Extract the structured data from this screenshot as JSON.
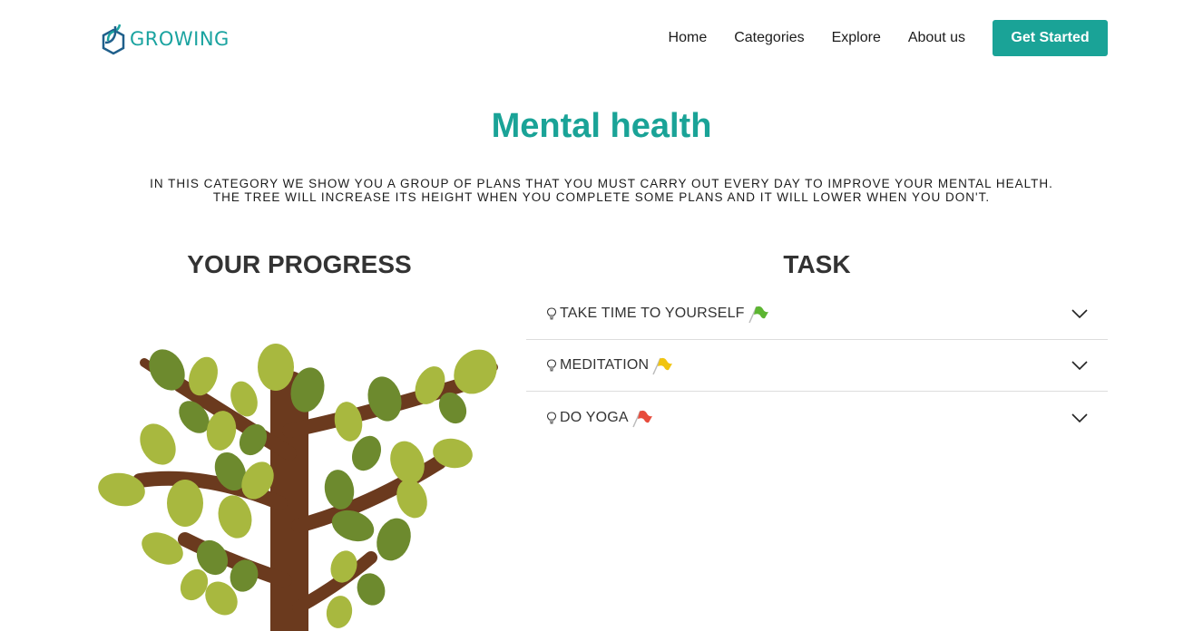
{
  "brand": {
    "name": "GROWING",
    "color": "#1aa3a0"
  },
  "nav": {
    "links": [
      "Home",
      "Categories",
      "Explore",
      "About us"
    ],
    "cta_label": "Get Started"
  },
  "page": {
    "title": "Mental health",
    "intro": "IN THIS CATEGORY WE SHOW YOU A GROUP OF PLANS THAT YOU MUST CARRY OUT EVERY DAY TO IMPROVE YOUR MENTAL HEALTH. THE TREE WILL INCREASE ITS HEIGHT WHEN YOU COMPLETE SOME PLANS AND IT WILL LOWER WHEN YOU DON'T."
  },
  "progress": {
    "heading": "YOUR PROGRESS"
  },
  "tasks": {
    "heading": "TASK",
    "items": [
      {
        "label": "TAKE TIME TO YOURSELF",
        "flag_color": "#5cb531",
        "icon": "lightbulb-icon"
      },
      {
        "label": "MEDITATION",
        "flag_color": "#f1c40f",
        "icon": "lightbulb-icon"
      },
      {
        "label": "DO YOGA",
        "flag_color": "#e74c3c",
        "icon": "lightbulb-icon"
      }
    ]
  },
  "colors": {
    "accent": "#1aa397",
    "trunk": "#6b3a1e",
    "leaf_light": "#a8b83f",
    "leaf_dark": "#6d8a2e"
  }
}
